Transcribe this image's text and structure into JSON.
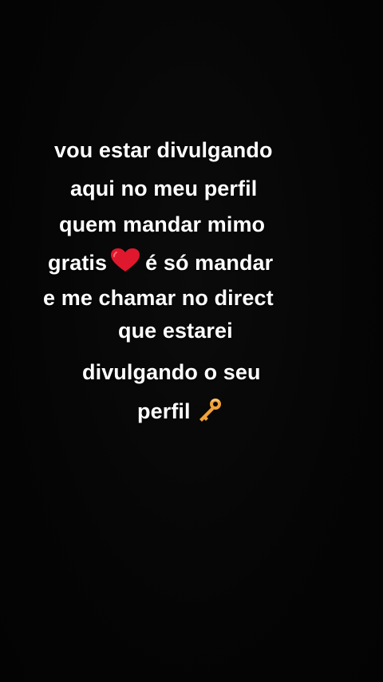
{
  "story": {
    "lines": [
      "vou estar divulgando",
      "aqui no meu perfil",
      "quem mandar mimo",
      "gratis",
      "é só mandar",
      "e me chamar no direct",
      "que estarei",
      "divulgando o seu",
      "perfil"
    ],
    "icons": [
      "red-heart-icon",
      "key-icon"
    ]
  },
  "colors": {
    "background": "#050505",
    "text": "#ffffff",
    "heart": "#e0182d",
    "key": "#f0a23a"
  }
}
